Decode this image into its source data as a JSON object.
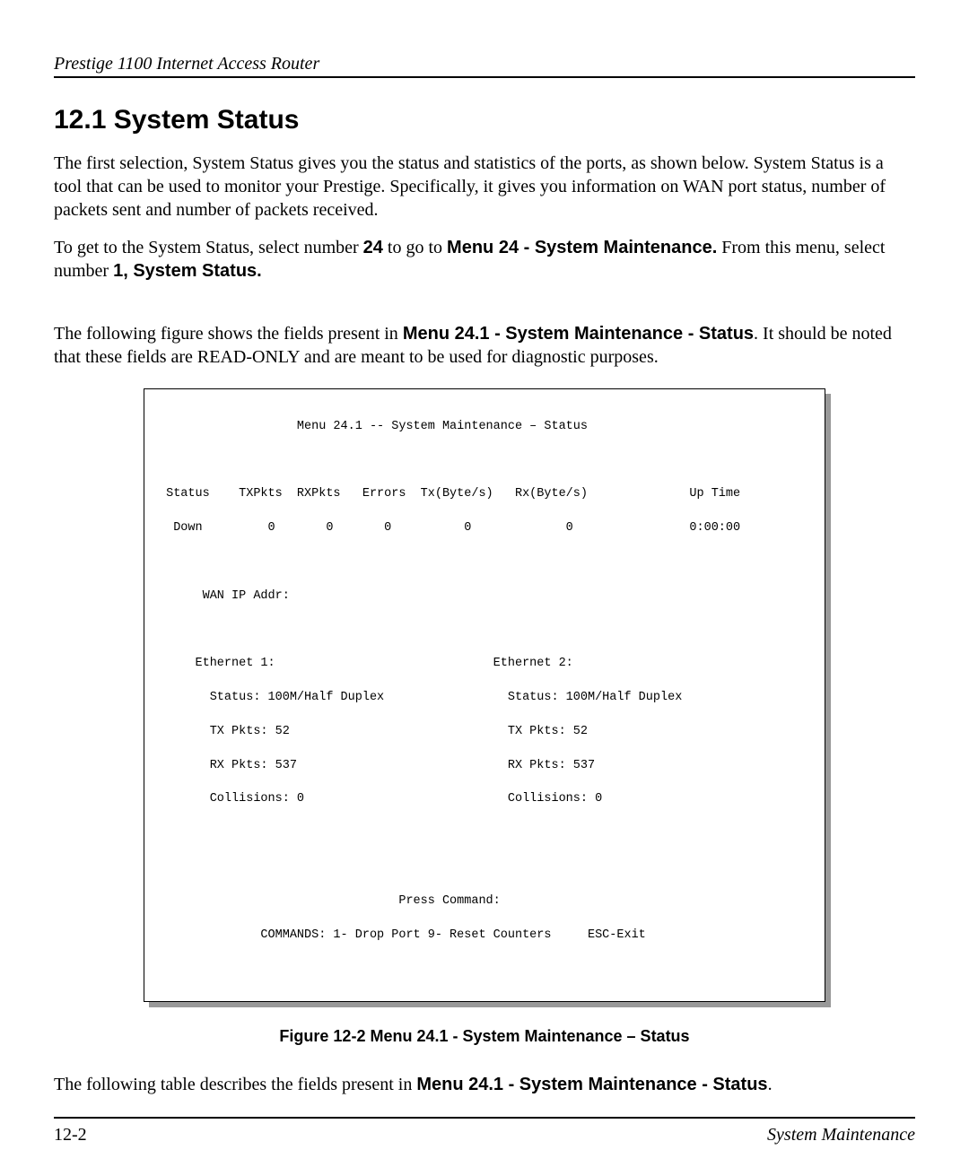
{
  "header": {
    "title": "Prestige 1100 Internet Access Router"
  },
  "section": {
    "heading": "12.1  System Status",
    "para1": "The first selection, System Status gives you the status and statistics of the ports, as shown below. System Status is a tool that can be used to monitor your Prestige. Specifically, it gives you information on WAN port status, number of packets sent and number of packets received.",
    "para2_prefix": "To get to the System Status, select number ",
    "para2_b1": "24",
    "para2_mid": " to go to ",
    "para2_b2": "Menu 24 - System Maintenance.",
    "para2_tail": " From this menu, select number ",
    "para2_b3": "1, System Status.",
    "para3_prefix": "The following figure shows the fields present in ",
    "para3_b1": "Menu 24.1 - System Maintenance - Status",
    "para3_tail": ". It should be noted that these fields are READ-ONLY and are meant to be used for diagnostic purposes.",
    "para4_prefix": "The following table describes the fields present in ",
    "para4_b1": "Menu 24.1 - System Maintenance - Status",
    "para4_tail": "."
  },
  "figure": {
    "title_line": "                   Menu 24.1 -- System Maintenance – Status",
    "header_line": " Status    TXPkts  RXPkts   Errors  Tx(Byte/s)   Rx(Byte/s)              Up Time",
    "data_line": "  Down         0       0       0          0             0                0:00:00",
    "wan_line": "      WAN IP Addr:",
    "eth_header": "     Ethernet 1:                              Ethernet 2:",
    "status_line": "       Status: 100M/Half Duplex                 Status: 100M/Half Duplex",
    "tx_line": "       TX Pkts: 52                              TX Pkts: 52",
    "rx_line": "       RX Pkts: 537                             RX Pkts: 537",
    "coll_line": "       Collisions: 0                            Collisions: 0",
    "press_line": "                                 Press Command:",
    "commands_line": "              COMMANDS: 1- Drop Port 9- Reset Counters     ESC-Exit",
    "caption": "Figure 12-2 Menu 24.1 - System Maintenance – Status"
  },
  "footer": {
    "page": "12-2",
    "section": "System Maintenance"
  },
  "chart_data": {
    "type": "table",
    "title": "Menu 24.1 -- System Maintenance – Status",
    "summary_columns": [
      "Status",
      "TXPkts",
      "RXPkts",
      "Errors",
      "Tx(Byte/s)",
      "Rx(Byte/s)",
      "Up Time"
    ],
    "summary_row": [
      "Down",
      0,
      0,
      0,
      0,
      0,
      "0:00:00"
    ],
    "wan_ip_addr": "",
    "ethernet": [
      {
        "name": "Ethernet 1",
        "status": "100M/Half Duplex",
        "tx_pkts": 52,
        "rx_pkts": 537,
        "collisions": 0
      },
      {
        "name": "Ethernet 2",
        "status": "100M/Half Duplex",
        "tx_pkts": 52,
        "rx_pkts": 537,
        "collisions": 0
      }
    ],
    "commands": {
      "1": "Drop Port",
      "9": "Reset Counters",
      "ESC": "Exit"
    }
  }
}
